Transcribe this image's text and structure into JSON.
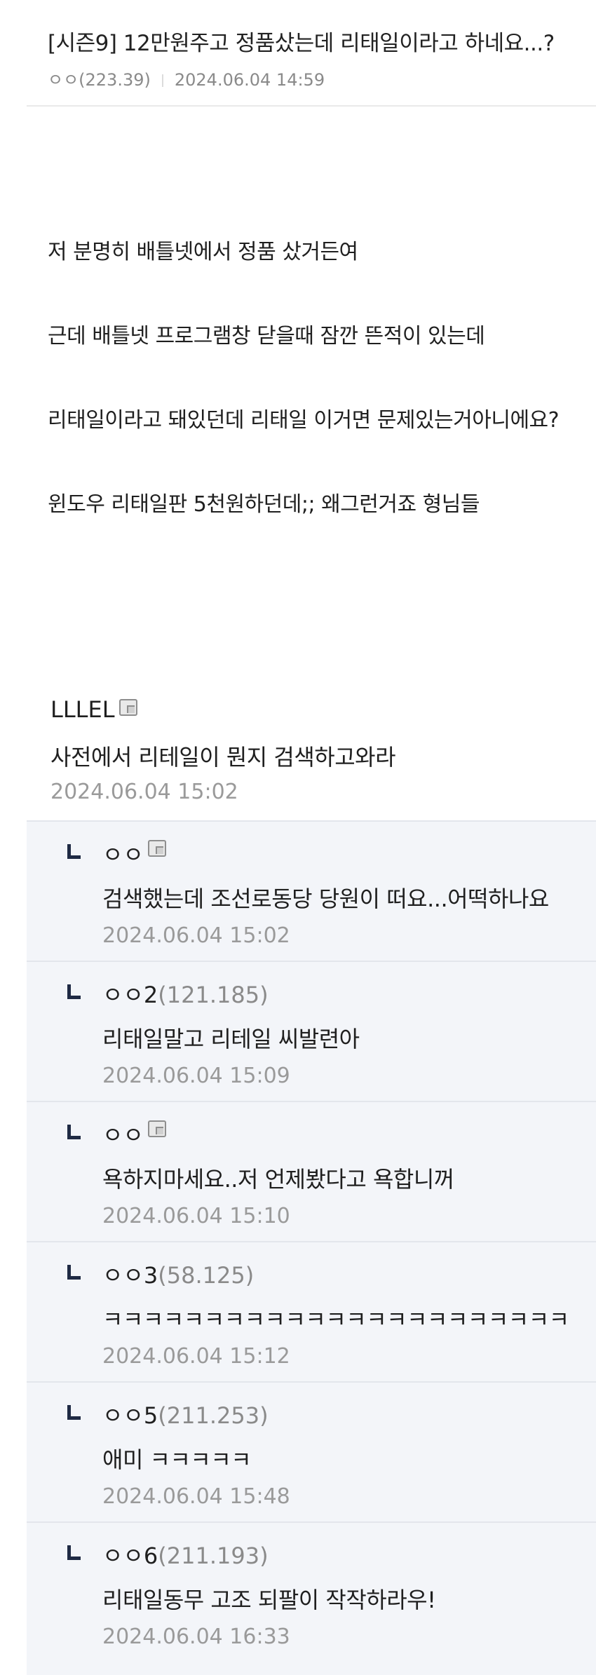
{
  "post": {
    "title": "[시즌9] 12만원주고 정품샀는데 리태일이라고 하네요...?",
    "author": "ㅇㅇ(223.39)",
    "date": "2024.06.04 14:59",
    "lines": [
      "저 분명히 배틀넷에서 정품 샀거든여",
      "근데 배틀넷 프로그램창 닫을때 잠깐 뜬적이 있는데",
      "리태일이라고 돼있던데 리태일 이거면 문제있는거아니에요?",
      "윈도우 리태일판 5천원하던데;; 왜그런거죠 형님들"
    ]
  },
  "comments": [
    {
      "author": "LLLEL",
      "ip": "",
      "has_memo_icon": true,
      "text": "사전에서 리테일이 뭔지 검색하고와라",
      "date": "2024.06.04 15:02"
    },
    {
      "author": "ㅇㅇ",
      "ip": "",
      "has_memo_icon": true,
      "text": "검색했는데 조선로동당 당원이 떠요...어떡하나요",
      "date": "2024.06.04 15:02"
    },
    {
      "author": "ㅇㅇ2",
      "ip": "(121.185)",
      "has_memo_icon": false,
      "text": "리태일말고 리테일 씨발련아",
      "date": "2024.06.04 15:09"
    },
    {
      "author": "ㅇㅇ",
      "ip": "",
      "has_memo_icon": true,
      "text": "욕하지마세요..저 언제봤다고 욕합니꺼",
      "date": "2024.06.04 15:10"
    },
    {
      "author": "ㅇㅇ3",
      "ip": "(58.125)",
      "has_memo_icon": false,
      "text": "ㅋㅋㅋㅋㅋㅋㅋㅋㅋㅋㅋㅋㅋㅋㅋㅋㅋㅋㅋㅋㅋㅋㅋ",
      "date": "2024.06.04 15:12"
    },
    {
      "author": "ㅇㅇ5",
      "ip": "(211.253)",
      "has_memo_icon": false,
      "text": "애미 ㅋㅋㅋㅋㅋ",
      "date": "2024.06.04 15:48"
    },
    {
      "author": "ㅇㅇ6",
      "ip": "(211.193)",
      "has_memo_icon": false,
      "text": "리태일동무 고조 되팔이 작작하라우!",
      "date": "2024.06.04 16:33"
    }
  ]
}
